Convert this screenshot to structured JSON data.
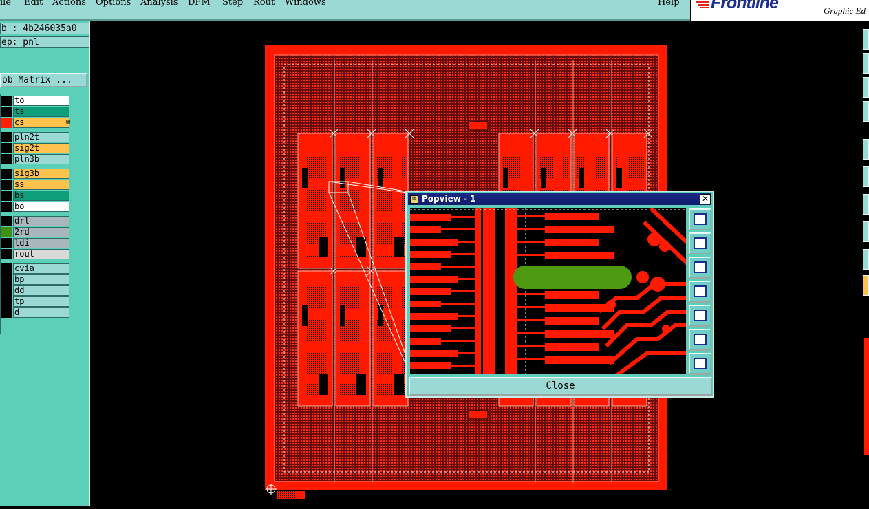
{
  "menubar": {
    "items": [
      "ile",
      "Edit",
      "Actions",
      "Options",
      "Analysis",
      "DFM",
      "Step",
      "Rout",
      "Windows"
    ],
    "help": "Help"
  },
  "logo": {
    "brand": "Frontline",
    "subtitle": "Graphic Ed"
  },
  "info": {
    "job": "b : 4b246035a0",
    "step": "ep: pnl"
  },
  "matrix_button": "ob Matrix ...",
  "layers": [
    {
      "name": "to",
      "color": "#ffffff",
      "swatch": "#000000",
      "mark": ""
    },
    {
      "name": "ts",
      "color": "#0f9e7a",
      "swatch": "#000000",
      "mark": ""
    },
    {
      "name": "cs",
      "color": "#ffc34d",
      "swatch": "#ff2000",
      "mark": "⊞"
    },
    {
      "name": "pln2t",
      "color": "#9ad9d4",
      "swatch": "#000000",
      "mark": ""
    },
    {
      "name": "sig2t",
      "color": "#ffc34d",
      "swatch": "#000000",
      "mark": ""
    },
    {
      "name": "pln3b",
      "color": "#9ad9d4",
      "swatch": "#000000",
      "mark": ""
    },
    {
      "name": "sig3b",
      "color": "#ffc34d",
      "swatch": "#000000",
      "mark": ""
    },
    {
      "name": "ss",
      "color": "#ffc34d",
      "swatch": "#000000",
      "mark": ""
    },
    {
      "name": "bs",
      "color": "#0f9e7a",
      "swatch": "#000000",
      "mark": ""
    },
    {
      "name": "bo",
      "color": "#ffffff",
      "swatch": "#000000",
      "mark": ""
    },
    {
      "name": "drl",
      "color": "#a9b7bd",
      "swatch": "#000000",
      "mark": ""
    },
    {
      "name": "2rd",
      "color": "#a9b7bd",
      "swatch": "#3f8f12",
      "mark": ""
    },
    {
      "name": "ldi",
      "color": "#a9b7bd",
      "swatch": "#000000",
      "mark": ""
    },
    {
      "name": "rout",
      "color": "#d9d9d9",
      "swatch": "#000000",
      "mark": ""
    },
    {
      "name": "cvia",
      "color": "#9ad9d4",
      "swatch": "#000000",
      "mark": ""
    },
    {
      "name": "bp",
      "color": "#9ad9d4",
      "swatch": "#000000",
      "mark": ""
    },
    {
      "name": "dd",
      "color": "#9ad9d4",
      "swatch": "#000000",
      "mark": ""
    },
    {
      "name": "tp",
      "color": "#9ad9d4",
      "swatch": "#000000",
      "mark": ""
    },
    {
      "name": "d",
      "color": "#9ad9d4",
      "swatch": "#000000",
      "mark": ""
    }
  ],
  "popview": {
    "title": "Popview - 1",
    "close_x": "✕",
    "close_label": "Close",
    "tools": [
      "zoom-fit-icon",
      "pan-up-icon",
      "pan-down-icon",
      "pan-left-icon",
      "pan-right-icon",
      "zoom-in-icon",
      "zoom-out-icon"
    ]
  },
  "colors": {
    "copper": "#ff1a00",
    "board_dark": "#5a0e0e",
    "pad_green": "#4d9a10",
    "panel": "#5ccfb8",
    "menu": "#9ad9d4",
    "title": "#1a2a85"
  }
}
